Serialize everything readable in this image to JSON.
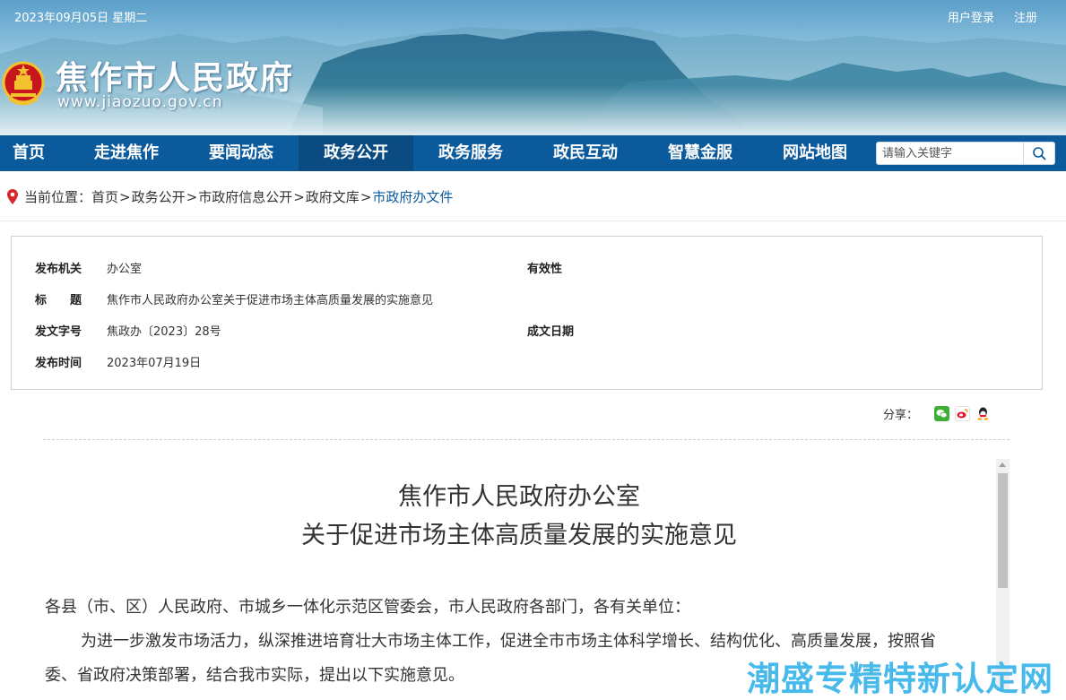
{
  "topbar": {
    "date": "2023年09月05日  星期二",
    "login": "用户登录",
    "register": "注册"
  },
  "header": {
    "site_title": "焦作市人民政府",
    "site_url": "www.jiaozuo.gov.cn"
  },
  "nav": {
    "items": [
      {
        "label": "首页"
      },
      {
        "label": "走进焦作"
      },
      {
        "label": "要闻动态"
      },
      {
        "label": "政务公开"
      },
      {
        "label": "政务服务"
      },
      {
        "label": "政民互动"
      },
      {
        "label": "智慧金服"
      },
      {
        "label": "网站地图"
      }
    ],
    "active": "政务公开",
    "search_placeholder": "请输入关键字"
  },
  "breadcrumb": {
    "prefix": "当前位置：",
    "items": [
      "首页",
      "政务公开",
      "市政府信息公开",
      "政府文库",
      "市政府办文件"
    ],
    "separator": ">"
  },
  "info": {
    "publisher_label": "发布机关",
    "publisher_value": "办公室",
    "validity_label": "有效性",
    "validity_value": "",
    "title_label": "标　　题",
    "title_value": "焦作市人民政府办公室关于促进市场主体高质量发展的实施意见",
    "doc_no_label": "发文字号",
    "doc_no_value": "焦政办〔2023〕28号",
    "written_date_label": "成文日期",
    "written_date_value": "",
    "publish_time_label": "发布时间",
    "publish_time_value": "2023年07月19日"
  },
  "share": {
    "label": "分享：",
    "icons": [
      "wechat-icon",
      "weibo-icon",
      "qq-icon"
    ]
  },
  "document": {
    "title_line1": "焦作市人民政府办公室",
    "title_line2": "关于促进市场主体高质量发展的实施意见",
    "addressee": "各县（市、区）人民政府、市城乡一体化示范区管委会，市人民政府各部门，各有关单位：",
    "para1_line1": "为进一步激发市场活力，纵深推进培育壮大市场主体工作，促进全市市场主体科学增长、结构优化、高质量发展，按照省",
    "para1_line2": "委、省政府决策部署，结合我市实际，提出以下实施意见。"
  },
  "watermark": "潮盛专精特新认定网",
  "colors": {
    "nav_bg": "#0b5a9c",
    "nav_active": "#0a4b82",
    "link_current": "#0b5a9c",
    "watermark": "#3eb6ea"
  }
}
